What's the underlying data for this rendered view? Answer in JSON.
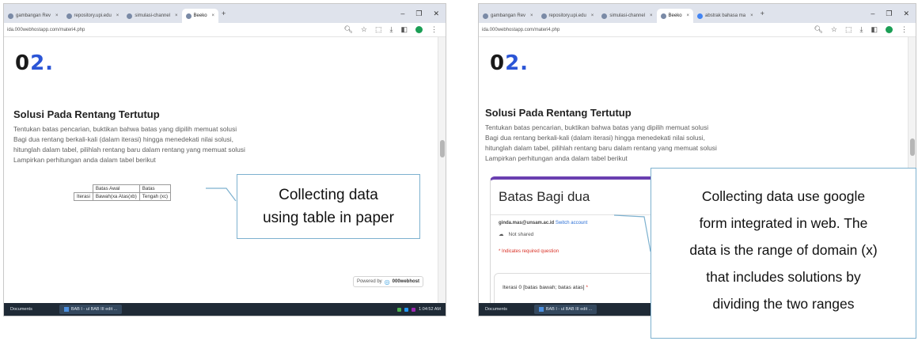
{
  "left": {
    "tabs": [
      {
        "label": "gambangan Rev",
        "active": false
      },
      {
        "label": "repository.upi.edu",
        "active": false
      },
      {
        "label": "simulasi-channel",
        "active": false
      },
      {
        "label": "Beeko",
        "active": true
      }
    ],
    "address": "ida.000webhostapp.com/materi4.php",
    "page": {
      "number": "0",
      "number_accent": "2.",
      "section_title": "Solusi Pada Rentang Tertutup",
      "paragraph_lines": [
        "Tentukan batas pencarian, buktikan bahwa batas yang dipilih memuat solusi",
        "Bagi dua rentang berkali-kali (dalam iterasi) hingga menedekati nilai solusi,",
        "hitunglah dalam tabel, pilihlah rentang baru dalam rentang yang memuat solusi",
        "Lampirkan perhitungan anda dalam tabel berikut"
      ],
      "table": {
        "row1": [
          "",
          "Batas Awal",
          "Batas"
        ],
        "row2": [
          "Iterasi",
          "Bawah(xa Atas(xb)",
          "Tengah (xc)"
        ]
      }
    },
    "callout_lines": [
      "Collecting data",
      "using table in paper"
    ],
    "credit": {
      "prefix": "Powered by",
      "brand": "000webhost"
    },
    "taskbar": {
      "start_label": "Documents",
      "app_label": "BAB I - ul BAB III edit ...",
      "clock": "1:04:52 AM"
    }
  },
  "right": {
    "tabs": [
      {
        "label": "gambangan Rev",
        "active": false
      },
      {
        "label": "repository.upi.edu",
        "active": false
      },
      {
        "label": "simulasi-channel",
        "active": false
      },
      {
        "label": "Beeko",
        "active": true
      },
      {
        "label": "abstrak bahasa ma",
        "active": false
      }
    ],
    "address": "ida.000webhostapp.com/materi4.php",
    "page": {
      "number": "0",
      "number_accent": "2.",
      "section_title": "Solusi Pada Rentang Tertutup",
      "paragraph_lines": [
        "Tentukan batas pencarian, buktikan bahwa batas yang dipilih memuat solusi",
        "Bagi dua rentang berkali-kali (dalam iterasi) hingga menedekati nilai solusi,",
        "hitunglah dalam tabel, pilihlah rentang baru dalam rentang yang memuat solusi",
        "Lampirkan perhitungan anda dalam tabel berikut"
      ]
    },
    "form": {
      "title": "Batas Bagi dua",
      "email": "ginda.mas@unsam.ac.id",
      "switch_account": "Switch account",
      "not_shared": "Not shared",
      "required_note": "* Indicates required question",
      "question": "Iterasi 0 [batas bawah; batas atas]",
      "question_req": "*"
    },
    "callout_lines": [
      "Collecting data use google",
      "form integrated in web. The",
      "data is the range of domain (x)",
      "that includes solutions by",
      "dividing the two ranges"
    ],
    "taskbar": {
      "start_label": "Documents",
      "app_label": "BAB I - ul BAB III edit ..."
    }
  },
  "colors": {
    "accent_blue": "#2b55d6",
    "form_purple": "#6a3fb0",
    "callout_border": "#7db1cf",
    "taskbar": "#1f2a36"
  }
}
